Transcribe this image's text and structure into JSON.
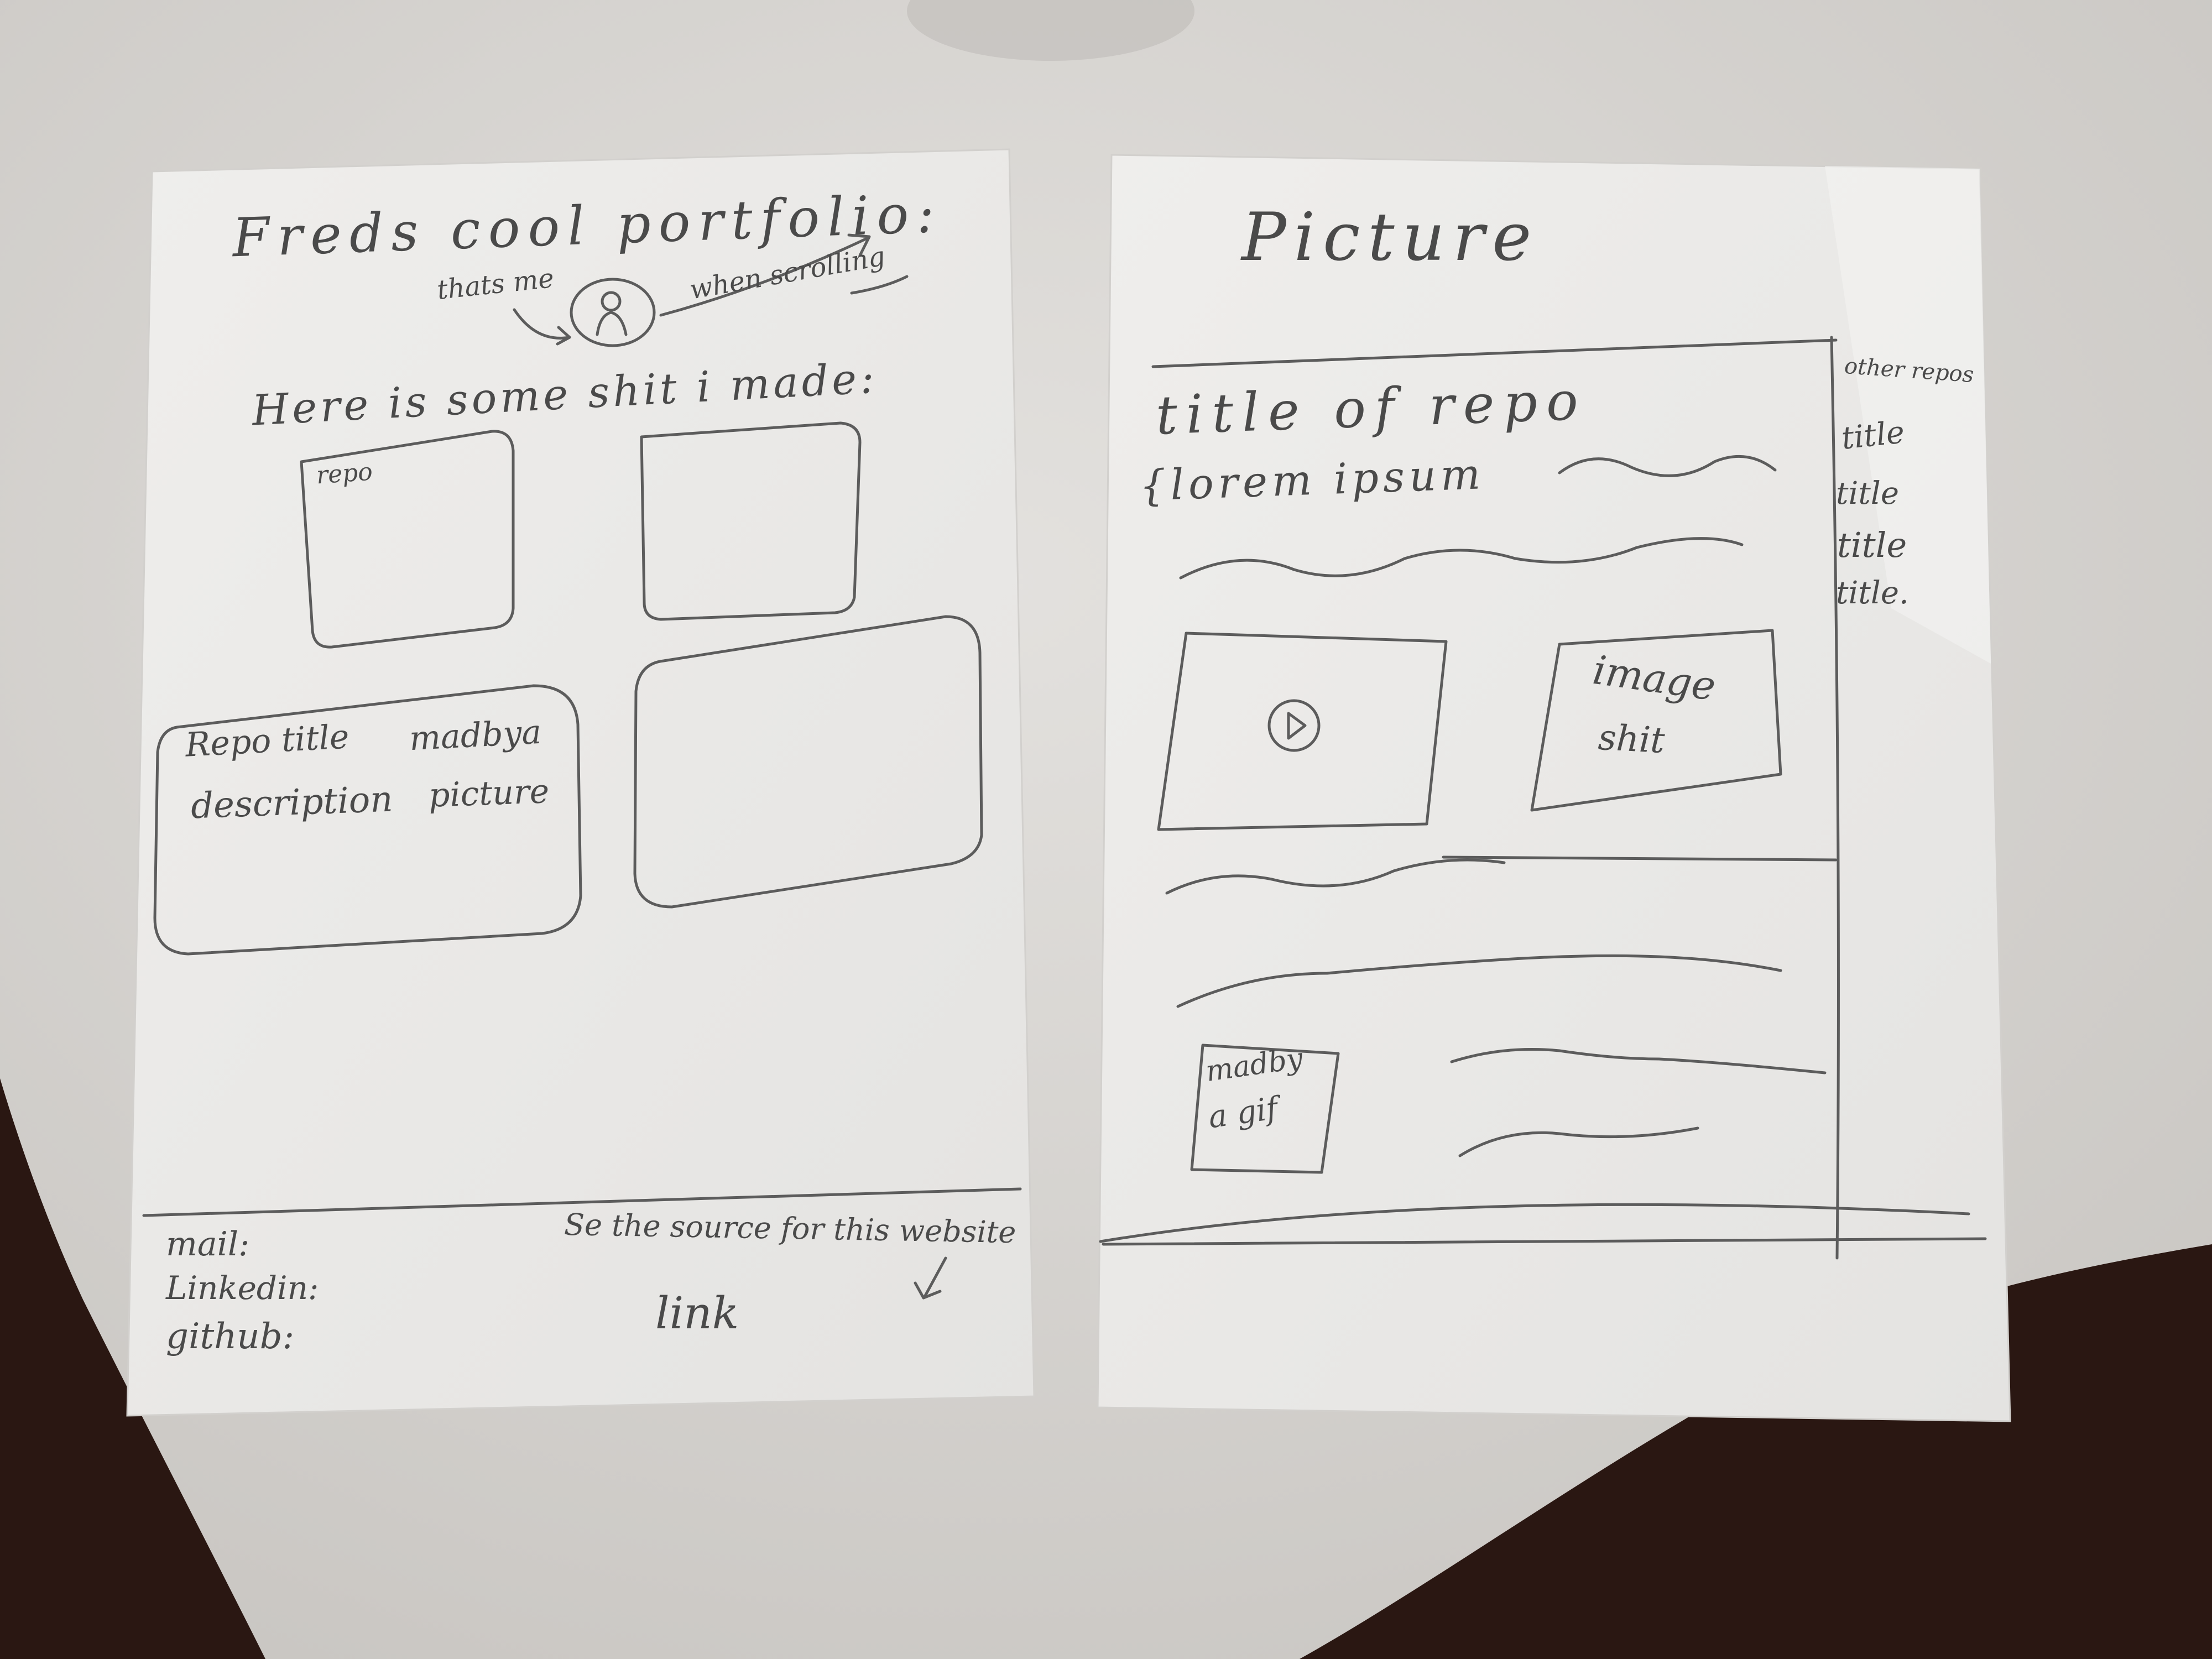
{
  "left_sheet": {
    "title": "Freds cool portfolio:",
    "note_thats_me": "thats me",
    "note_when_scrolling": "when scrolling",
    "intro": "Here is some shit i made:",
    "card1_label": "repo",
    "card3_line1": "Repo title",
    "card3_line2": "description",
    "card3_line3": "madbyа",
    "card3_line4": "picture",
    "footer": {
      "mail": "mail:",
      "linkedin": "Linkedin:",
      "github": "github:",
      "source_note": "Se the source for this website",
      "link": "link"
    }
  },
  "right_sheet": {
    "title": "Picture",
    "repo_title": "title of repo",
    "lorem": "{lorem ipsum",
    "image_label_1": "image",
    "image_label_2": "shit",
    "gif_label_1": "madby",
    "gif_label_2": "a gif",
    "sidebar": {
      "heading": "other repos",
      "items": [
        "title",
        "title",
        "title",
        "title."
      ]
    }
  },
  "colors": {
    "table": "#d7d5d2",
    "paper": "#ecebe9",
    "pencil": "#5a5a5a",
    "floor": "#2a1712"
  }
}
